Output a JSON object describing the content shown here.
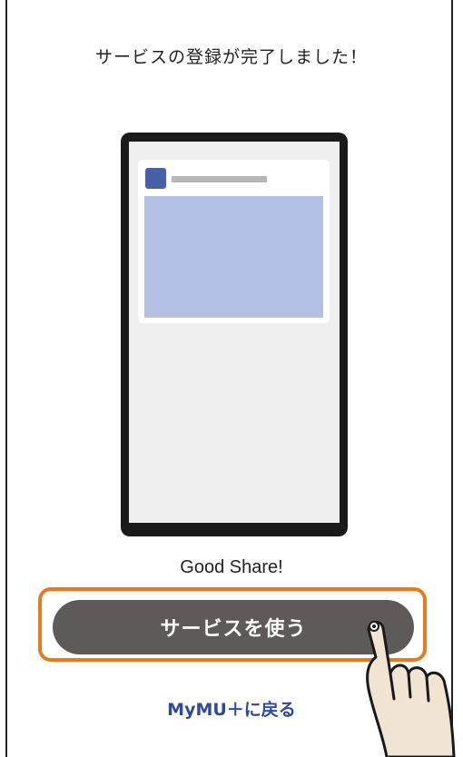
{
  "header": {
    "message": "サービスの登録が完了しました！"
  },
  "illustration": {
    "caption": "Good Share!"
  },
  "actions": {
    "use_service_label": "サービスを使う",
    "back_label": "MyMU＋に戻る"
  },
  "colors": {
    "button_bg": "#5e5a5a",
    "highlight_border": "#e87a1e",
    "link": "#2d4a9c",
    "card_accent": "#4a5faa",
    "card_image": "#b4c0e4"
  },
  "icons": {
    "pointer": "tapping-hand-icon"
  }
}
